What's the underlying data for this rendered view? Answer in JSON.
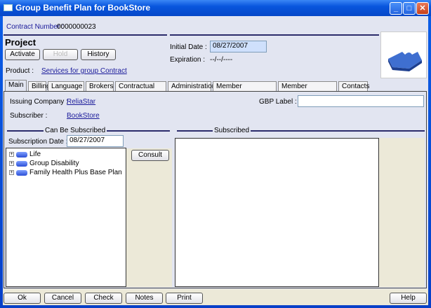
{
  "window": {
    "title": "Group Benefit Plan for BookStore"
  },
  "header": {
    "contract_label": "Contract Number :",
    "contract_number": "0000000023",
    "section_title": "Project",
    "buttons": {
      "activate": "Activate",
      "hold": "Hold",
      "history": "History"
    },
    "product_label": "Product :",
    "product_value": "Services for group Contract",
    "initial_date_label": "Initial Date :",
    "initial_date": "08/27/2007",
    "expiration_label": "Expiration :",
    "expiration_value": "--/--/----"
  },
  "tabs": [
    "Main",
    "Billing",
    "Language",
    "Brokers",
    "Contractual Data",
    "Administration",
    "Member Management",
    "Member Coverages",
    "Contacts"
  ],
  "active_tab": "Main",
  "main": {
    "issuing_company_label": "Issuing Company :",
    "issuing_company": "ReliaStar",
    "subscriber_label": "Subscriber :",
    "subscriber": "BookStore",
    "gbp_label": "GBP Label :",
    "gbp_value": "",
    "can_be_subscribed": "Can Be Subscribed",
    "subscription_date_label": "Subscription Date :",
    "subscription_date": "08/27/2007",
    "tree": [
      "Life",
      "Group Disability",
      "Family Health Plus Base Plan"
    ],
    "consult": "Consult",
    "subscribed": "Subscribed"
  },
  "footer": {
    "ok": "Ok",
    "cancel": "Cancel",
    "check": "Check",
    "notes": "Notes",
    "print": "Print",
    "help": "Help"
  }
}
